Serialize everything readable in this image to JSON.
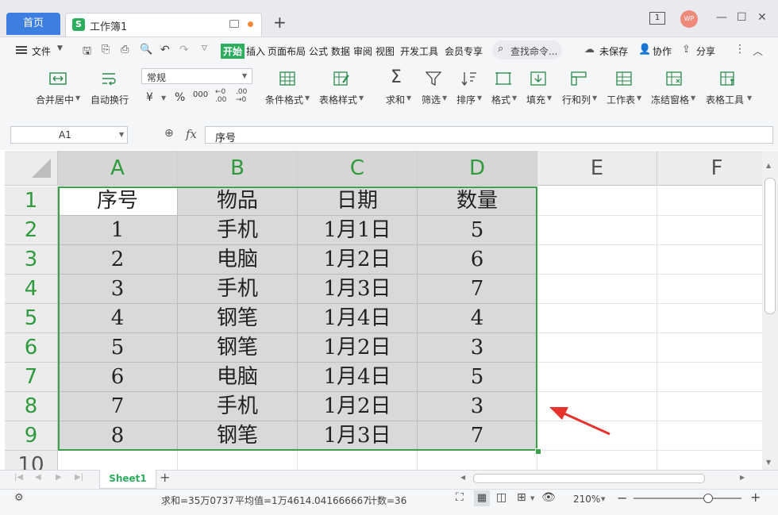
{
  "tabs": {
    "home": "首页",
    "document": "工作簿1",
    "doc_icon_letter": "S",
    "new_tab": "+"
  },
  "window": {
    "page_badge": "1",
    "avatar_text": "WP"
  },
  "menu": {
    "file": "文件",
    "items": [
      "开始",
      "插入",
      "页面布局",
      "公式",
      "数据",
      "审阅",
      "视图",
      "开发工具",
      "会员专享"
    ],
    "search": "查找命令...",
    "unsaved": "未保存",
    "collab": "协作",
    "share": "分享"
  },
  "ribbon": {
    "merge": "合并居中",
    "wrap": "自动换行",
    "format_value": "常规",
    "currency_symbol": "¥",
    "percent_symbol": "%",
    "thousands_symbol": "000",
    "cond_format": "条件格式",
    "table_style": "表格样式",
    "sum": "求和",
    "filter": "筛选",
    "sort": "排序",
    "format": "格式",
    "fill": "填充",
    "rowcol": "行和列",
    "worksheet": "工作表",
    "freeze": "冻结窗格",
    "table_tools": "表格工具"
  },
  "formula_bar": {
    "cell_ref": "A1",
    "fx": "fx",
    "content": "序号"
  },
  "sheet": {
    "columns": [
      "A",
      "B",
      "C",
      "D",
      "E",
      "F"
    ],
    "rows": [
      "1",
      "2",
      "3",
      "4",
      "5",
      "6",
      "7",
      "8",
      "9",
      "10"
    ],
    "cells": [
      [
        "序号",
        "物品",
        "日期",
        "数量"
      ],
      [
        "1",
        "手机",
        "1月1日",
        "5"
      ],
      [
        "2",
        "电脑",
        "1月2日",
        "6"
      ],
      [
        "3",
        "手机",
        "1月3日",
        "7"
      ],
      [
        "4",
        "钢笔",
        "1月4日",
        "4"
      ],
      [
        "5",
        "钢笔",
        "1月2日",
        "3"
      ],
      [
        "6",
        "电脑",
        "1月4日",
        "5"
      ],
      [
        "7",
        "手机",
        "1月2日",
        "3"
      ],
      [
        "8",
        "钢笔",
        "1月3日",
        "7"
      ]
    ]
  },
  "sheet_tabs": {
    "active": "Sheet1",
    "add": "+"
  },
  "status": {
    "sum": "求和=35万0737",
    "average": "平均值=1万4614.041666667",
    "count": "计数=36",
    "zoom": "210%"
  },
  "colors": {
    "accent_green": "#2dae5e",
    "selection_border": "#3aa24b",
    "home_tab": "#3d7fe0",
    "arrow": "#e8322d"
  }
}
